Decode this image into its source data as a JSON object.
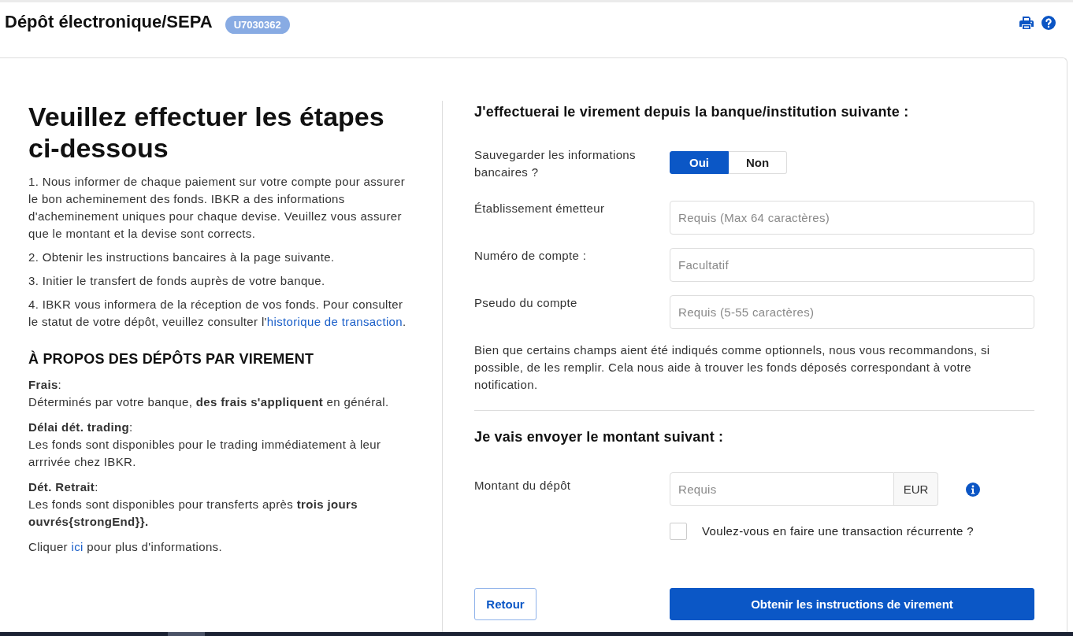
{
  "header": {
    "title": "Dépôt électronique/SEPA",
    "account_badge": "U7030362"
  },
  "instructions": {
    "title": "Veuillez effectuer les étapes ci-dessous",
    "steps": [
      {
        "text": "1. Nous informer de chaque paiement sur votre compte pour assurer le bon acheminement des fonds. IBKR a des informations d'acheminement uniques pour chaque devise. Veuillez vous assurer que le montant et la devise sont corrects."
      },
      {
        "text": "2. Obtenir les instructions bancaires à la page suivante."
      },
      {
        "text": "3. Initier le transfert de fonds auprès de votre banque."
      },
      {
        "text": "4. IBKR vous informera de la réception de vos fonds. Pour consulter le statut de votre dépôt, veuillez consulter l'",
        "link": "historique de transaction",
        "after": "."
      }
    ]
  },
  "about": {
    "title": "À PROPOS DES DÉPÔTS PAR VIREMENT",
    "items": [
      {
        "label": "**Frais**:",
        "text": "Déterminés par votre banque, **des frais s'appliquent** en général."
      },
      {
        "label": "**Délai dét. trading**:",
        "text": "Les fonds sont disponibles pour le trading immédiatement à leur arrrivée chez IBKR."
      },
      {
        "label": "**Dét. Retrait**:",
        "text": "Les fonds sont disponibles pour transferts après **trois jours ouvrés{strongEnd}}.**"
      }
    ],
    "more": {
      "before": "Cliquer ",
      "link": "ici",
      "after": " pour plus d'informations."
    }
  },
  "bank_form": {
    "title": "J'effectuerai le virement depuis la banque/institution suivante :",
    "fields": [
      {
        "kind": "toggle",
        "label": "Sauvegarder les informations bancaires ?",
        "options": [
          {
            "label": "Oui",
            "selected": true
          },
          {
            "label": "Non",
            "selected": false
          }
        ]
      },
      {
        "kind": "input",
        "label": "Établissement émetteur",
        "placeholder": "Requis (Max 64 caractères)"
      },
      {
        "kind": "input",
        "label": "Numéro de compte :",
        "placeholder": "Facultatif"
      },
      {
        "kind": "input",
        "label": "Pseudo du compte",
        "placeholder": "Requis (5-55 caractères)"
      }
    ],
    "note": "Bien que certains champs aient été indiqués comme optionnels, nous vous recommandons, si possible, de les remplir. Cela nous aide à trouver les fonds déposés correspondant à votre notification."
  },
  "amount_form": {
    "title": "Je vais envoyer le montant suivant :",
    "label": "Montant du dépôt",
    "placeholder": "Requis",
    "currency": "EUR",
    "recurring": {
      "label": "Voulez-vous en faire une transaction récurrente ?",
      "checked": false
    }
  },
  "buttons": [
    {
      "kind": "secondary",
      "label": "Retour"
    },
    {
      "kind": "primary",
      "label": "Obtenir les instructions de virement"
    }
  ]
}
